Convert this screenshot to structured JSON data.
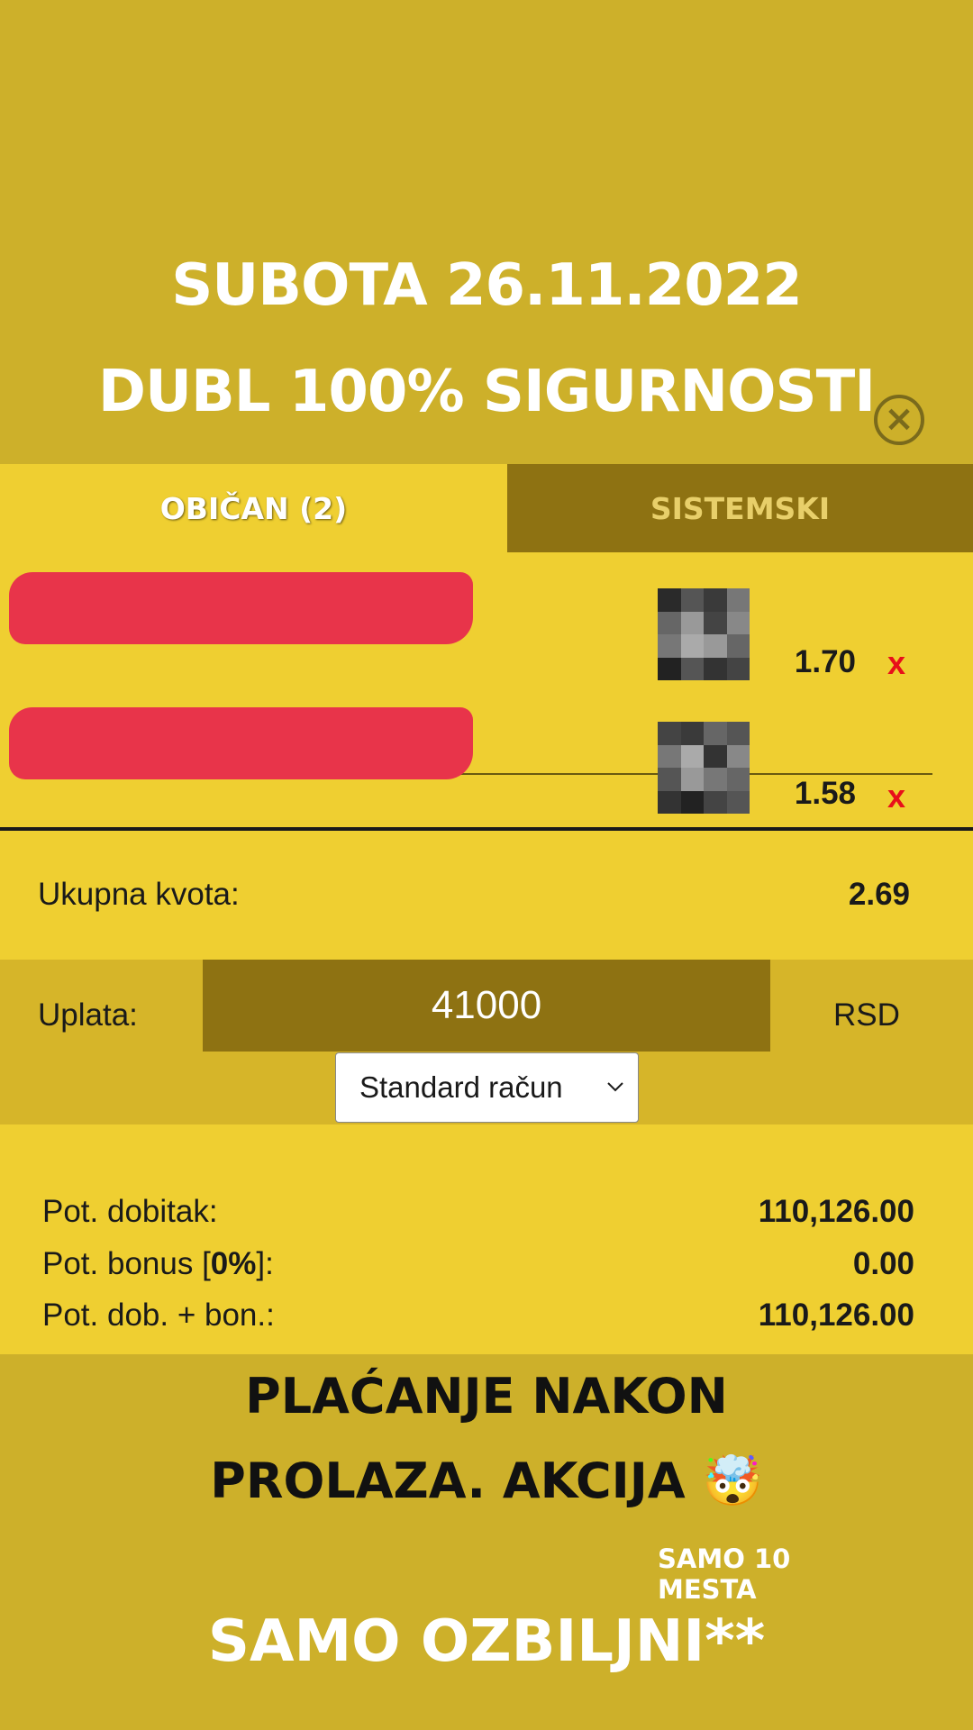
{
  "headline": {
    "line1": "SUBOTA 26.11.2022",
    "line2": "DUBL 100% SIGURNOSTI"
  },
  "tabs": [
    {
      "label": "OBIČAN (2)"
    },
    {
      "label": "SISTEMSKI"
    }
  ],
  "picks": [
    {
      "odds": "1.70",
      "remove": "x"
    },
    {
      "odds": "1.58",
      "remove": "x"
    }
  ],
  "summary": {
    "total_odds_label": "Ukupna kvota:",
    "total_odds_value": "2.69",
    "stake_label": "Uplata:",
    "stake_value": "41000",
    "currency": "RSD",
    "account_selected": "Standard račun"
  },
  "payout": {
    "win_label": "Pot. dobitak:",
    "win_value": "110,126.00",
    "bonus_label_prefix": "Pot. bonus [",
    "bonus_percent": "0%",
    "bonus_label_suffix": "]:",
    "bonus_value": "0.00",
    "total_label": "Pot. dob. + bon.:",
    "total_value": "110,126.00"
  },
  "promo": {
    "line1": "PLAĆANJE NAKON",
    "line2": "PROLAZA. AKCIJA 🤯",
    "line3": "SAMO 10 MESTA",
    "line4": "SAMO OZBILJNI**"
  },
  "colors": {
    "background": "#cdb02a",
    "slip": "#efcf31",
    "tab_inactive": "#8e7212",
    "redaction": "#e8344a",
    "remove_x": "#e8101a"
  },
  "icons": [
    "close-icon",
    "chevron-down-icon"
  ]
}
